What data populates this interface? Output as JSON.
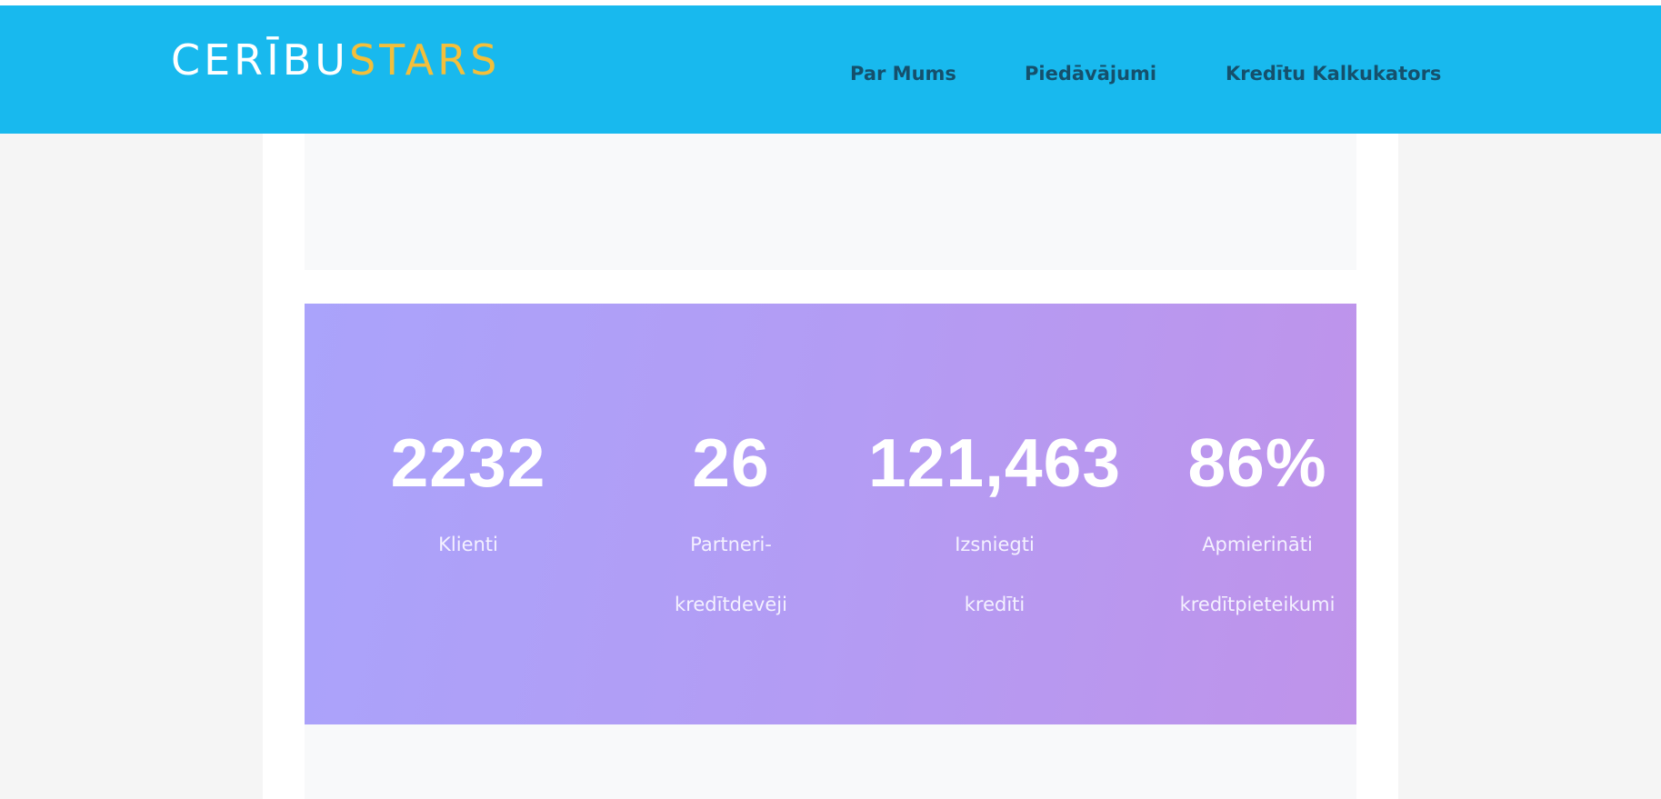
{
  "header": {
    "logo": {
      "part1": "CERĪBU",
      "part2": "STARS"
    },
    "nav": [
      {
        "label": "Par Mums"
      },
      {
        "label": "Piedāvājumi"
      },
      {
        "label": "Kredītu Kalkukators"
      }
    ]
  },
  "stats": [
    {
      "value": "2232",
      "label_line1": "Klienti",
      "label_line2": ""
    },
    {
      "value": "26",
      "label_line1": "Partneri-",
      "label_line2": "kredītdevēji"
    },
    {
      "value": "121,463",
      "label_line1": "Izsniegti",
      "label_line2": "kredīti"
    },
    {
      "value": "86%",
      "label_line1": "Apmierināti",
      "label_line2": "kredītpieteikumi"
    }
  ],
  "colors": {
    "header_bg": "#18b9ee",
    "logo_accent": "#f3bf3b",
    "nav_text": "#15506c",
    "stats_gradient_start": "#aaa3fb",
    "stats_gradient_end": "#bf93ea"
  }
}
